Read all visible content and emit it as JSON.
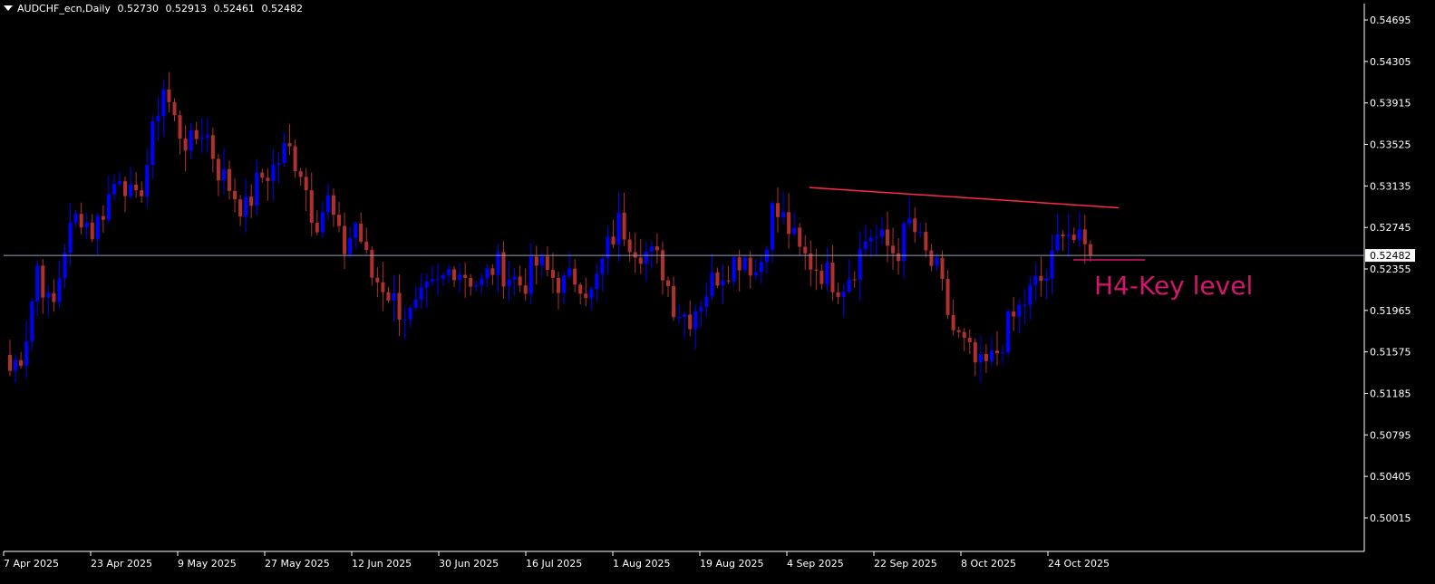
{
  "header": {
    "symbol": "AUDCHF_ecn,Daily",
    "open": "0.52730",
    "high": "0.52913",
    "low": "0.52461",
    "close": "0.52482"
  },
  "colors": {
    "background": "#000000",
    "bull": "#0000ff",
    "bear": "#b03030",
    "axis": "#ffffff",
    "price_line": "#8fa3b8",
    "trendline": "#ff2a4a",
    "annotation": "#d4166e"
  },
  "annotation_text": "H4-Key level",
  "current_price_label": "0.52482",
  "chart_data": {
    "type": "candlestick",
    "title": "",
    "ylim": [
      0.49836,
      0.54789
    ],
    "y_ticks": [
      "0.54695",
      "0.54305",
      "0.53915",
      "0.53525",
      "0.53135",
      "0.52745",
      "0.52355",
      "0.51965",
      "0.51575",
      "0.51185",
      "0.50795",
      "0.50405",
      "0.50015"
    ],
    "x_ticks": [
      "7 Apr 2025",
      "23 Apr 2025",
      "9 May 2025",
      "27 May 2025",
      "12 Jun 2025",
      "30 Jun 2025",
      "16 Jul 2025",
      "1 Aug 2025",
      "19 Aug 2025",
      "4 Sep 2025",
      "22 Sep 2025",
      "8 Oct 2025",
      "24 Oct 2025"
    ],
    "current_price": 0.52482,
    "trendline": {
      "start": {
        "bar": 0.9,
        "price": 0.5312
      },
      "end": {
        "bar": 1.2,
        "price": 0.5293
      }
    },
    "key_level": 0.5244,
    "waypoints": [
      0.514,
      0.516,
      0.524,
      0.519,
      0.526,
      0.529,
      0.527,
      0.53,
      0.533,
      0.529,
      0.534,
      0.541,
      0.537,
      0.535,
      0.537,
      0.533,
      0.531,
      0.529,
      0.532,
      0.533,
      0.535,
      0.533,
      0.528,
      0.53,
      0.525,
      0.528,
      0.523,
      0.522,
      0.52,
      0.519,
      0.521,
      0.522,
      0.524,
      0.523,
      0.522,
      0.524,
      0.523,
      0.522,
      0.524,
      0.523,
      0.522,
      0.523,
      0.521,
      0.525,
      0.528,
      0.526,
      0.525,
      0.524,
      0.52,
      0.519,
      0.521,
      0.523,
      0.524,
      0.525,
      0.523,
      0.529,
      0.528,
      0.525,
      0.524,
      0.523,
      0.522,
      0.524,
      0.527,
      0.526,
      0.525,
      0.528,
      0.525,
      0.523,
      0.518,
      0.516,
      0.514,
      0.515,
      0.518,
      0.52,
      0.522,
      0.523,
      0.528,
      0.526,
      0.525
    ]
  }
}
